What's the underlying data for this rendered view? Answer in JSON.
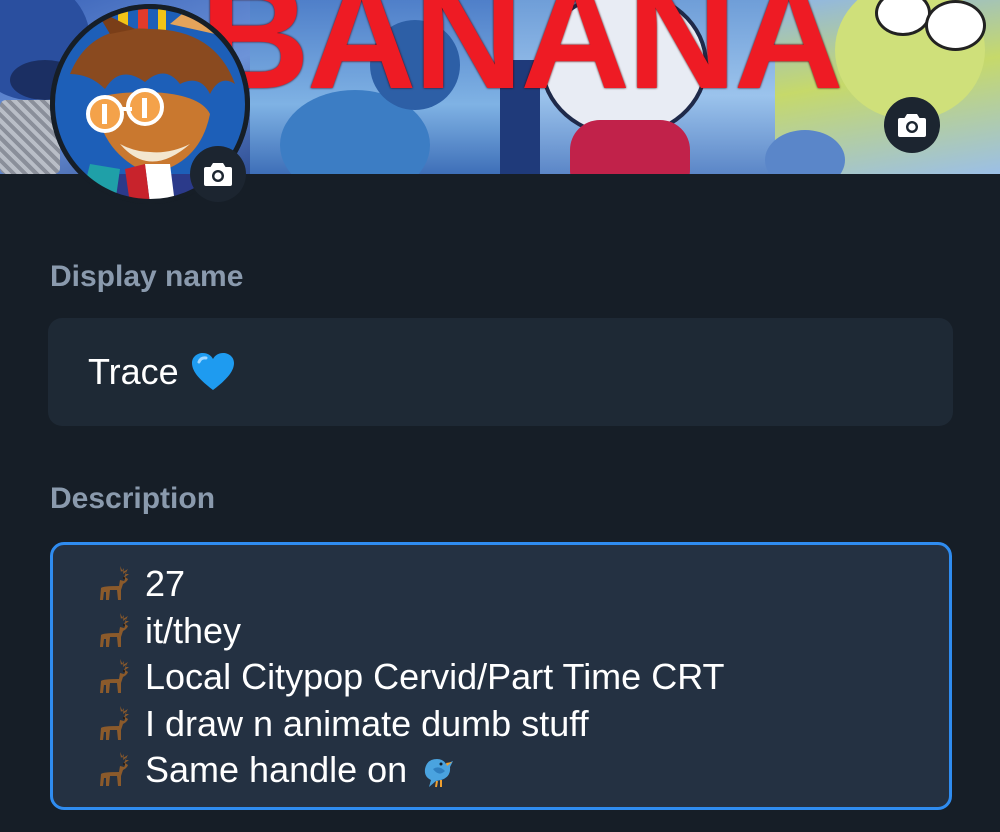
{
  "banner": {
    "title": "BANANA",
    "camera_icon": "camera-icon"
  },
  "avatar": {
    "camera_icon": "camera-icon"
  },
  "form": {
    "display_name": {
      "label": "Display name",
      "value": "Trace",
      "emoji": "blue-heart-icon"
    },
    "description": {
      "label": "Description",
      "lines": [
        {
          "emoji": "deer-icon",
          "text": "27"
        },
        {
          "emoji": "deer-icon",
          "text": "it/they"
        },
        {
          "emoji": "deer-icon",
          "text": "Local Citypop Cervid/Part Time CRT"
        },
        {
          "emoji": "deer-icon",
          "text": "I draw n animate dumb stuff"
        },
        {
          "emoji": "deer-icon",
          "text": "Same handle on",
          "trailing_emoji": "bird-icon"
        }
      ]
    }
  },
  "colors": {
    "background": "#161e27",
    "input_bg": "#1e2935",
    "focus_border": "#2f8cf0",
    "label": "#8a9aad",
    "banner_text": "#ee1b24"
  }
}
